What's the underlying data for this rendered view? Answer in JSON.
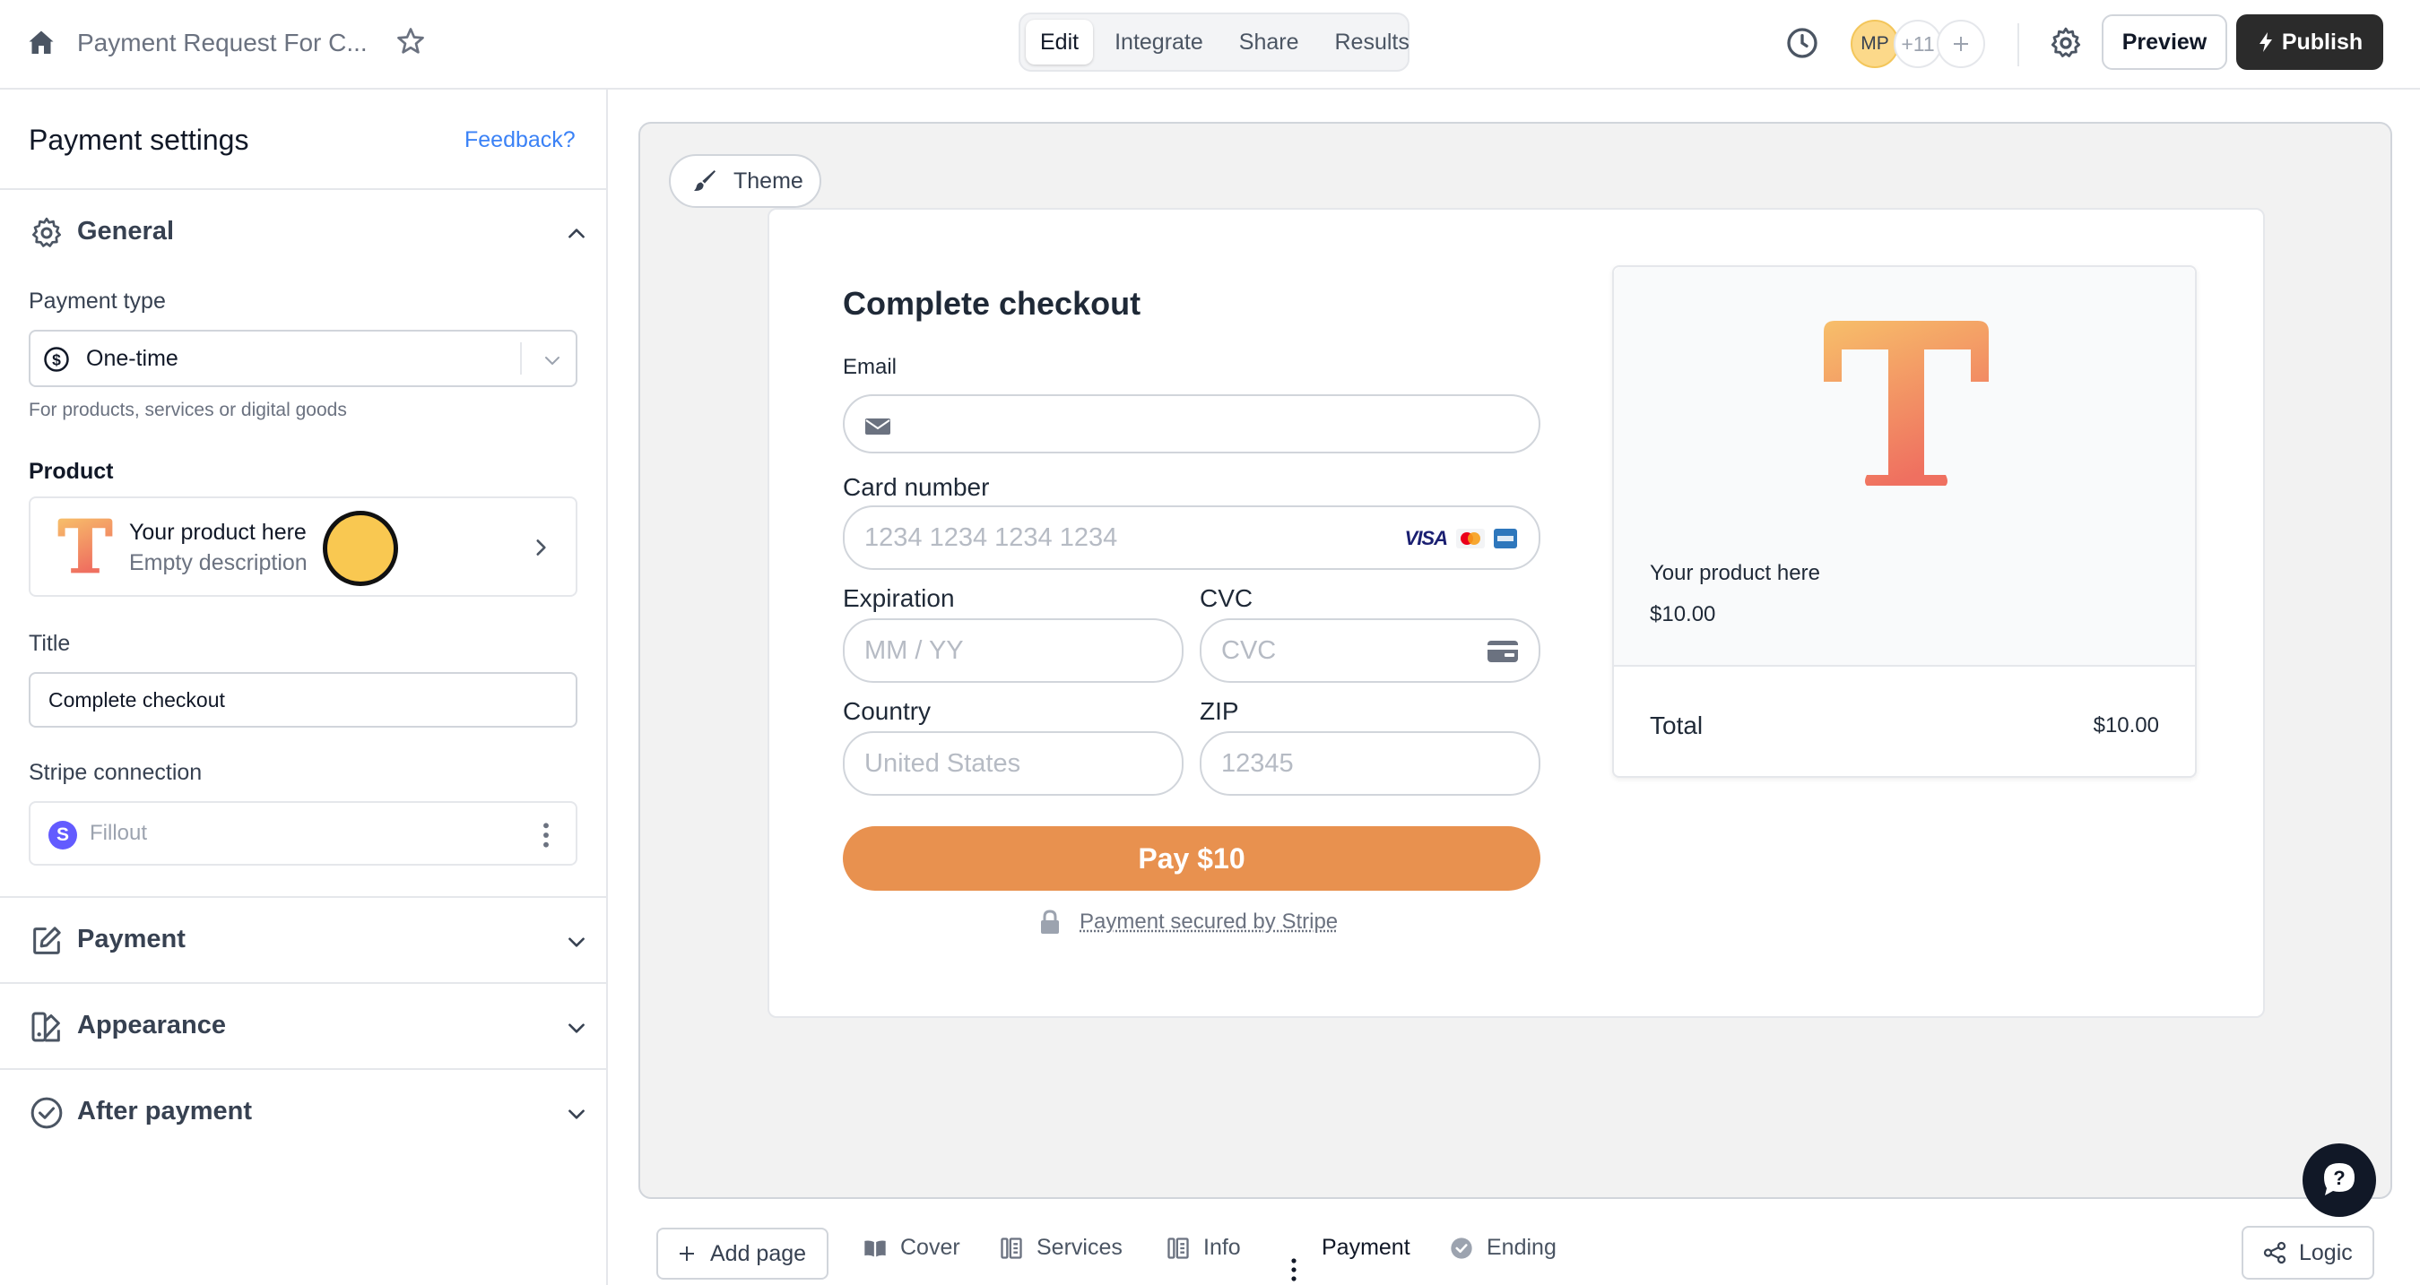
{
  "header": {
    "form_title": "Payment Request For C...",
    "tabs": [
      {
        "label": "Edit",
        "active": true
      },
      {
        "label": "Integrate",
        "active": false
      },
      {
        "label": "Share",
        "active": false
      },
      {
        "label": "Results",
        "active": false
      }
    ],
    "collaborator_initials": "MP",
    "collaborator_more": "+11",
    "preview_label": "Preview",
    "publish_label": "Publish"
  },
  "sidebar": {
    "title": "Payment settings",
    "feedback_link": "Feedback?",
    "general": {
      "label": "General",
      "payment_type_label": "Payment type",
      "payment_type_value": "One-time",
      "payment_type_help": "For products, services or digital goods",
      "product_label": "Product",
      "product_name": "Your product here",
      "product_description": "Empty description",
      "title_label": "Title",
      "title_value": "Complete checkout",
      "stripe_label": "Stripe connection",
      "stripe_account": "Fillout"
    },
    "sections": [
      {
        "label": "Payment",
        "icon": "edit-icon"
      },
      {
        "label": "Appearance",
        "icon": "appearance-icon"
      },
      {
        "label": "After payment",
        "icon": "check-circle-icon"
      }
    ]
  },
  "canvas": {
    "theme_label": "Theme",
    "checkout": {
      "title": "Complete checkout",
      "email_label": "Email",
      "card_label": "Card number",
      "card_placeholder": "1234 1234 1234 1234",
      "card_brand_visa": "VISA",
      "expiration_label": "Expiration",
      "expiration_placeholder": "MM / YY",
      "cvc_label": "CVC",
      "cvc_placeholder": "CVC",
      "country_label": "Country",
      "country_placeholder": "United States",
      "zip_label": "ZIP",
      "zip_placeholder": "12345",
      "pay_button": "Pay $10",
      "secured_text": "Payment secured by Stripe"
    },
    "summary": {
      "product_name": "Your product here",
      "product_price": "$10.00",
      "total_label": "Total",
      "total_value": "$10.00"
    }
  },
  "bottom": {
    "add_page_label": "Add page",
    "pages": [
      {
        "label": "Cover",
        "icon": "book-icon"
      },
      {
        "label": "Services",
        "icon": "form-page-icon"
      },
      {
        "label": "Info",
        "icon": "form-page-icon"
      },
      {
        "label": "Payment",
        "icon": "none",
        "active": true
      },
      {
        "label": "Ending",
        "icon": "check-circle-filled-icon"
      }
    ],
    "logic_label": "Logic"
  },
  "colors": {
    "accent_orange": "#e8914f",
    "link_blue": "#3b82f6",
    "stripe_purple": "#635bff",
    "publish_dark": "#2b2b2b"
  }
}
